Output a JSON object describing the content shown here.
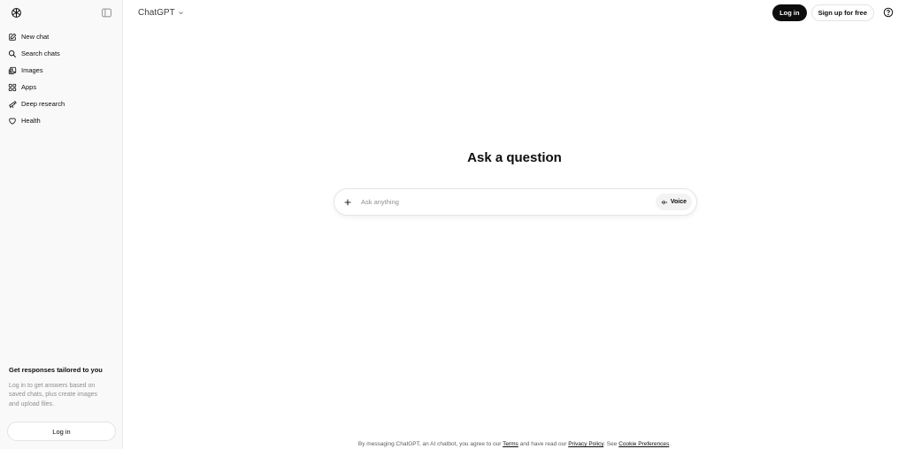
{
  "sidebar": {
    "items": [
      {
        "label": "New chat",
        "icon": "compose-icon"
      },
      {
        "label": "Search chats",
        "icon": "search-icon"
      },
      {
        "label": "Images",
        "icon": "images-icon"
      },
      {
        "label": "Apps",
        "icon": "apps-grid-icon"
      },
      {
        "label": "Deep research",
        "icon": "telescope-icon"
      },
      {
        "label": "Health",
        "icon": "heart-icon"
      }
    ],
    "promo_title": "Get responses tailored to you",
    "promo_text": "Log in to get answers based on saved chats, plus create images and upload files.",
    "login_label": "Log in"
  },
  "header": {
    "model_label": "ChatGPT",
    "login_label": "Log in",
    "signup_label": "Sign up for free"
  },
  "main": {
    "headline": "Ask a question",
    "input_placeholder": "Ask anything",
    "voice_label": "Voice"
  },
  "footer": {
    "prefix": "By messaging ChatGPT, an AI chatbot, you agree to our",
    "terms": "Terms",
    "middle": "and have read our",
    "privacy": "Privacy Policy",
    "see": ". See",
    "cookie": "Cookie Preferences",
    "end": "."
  },
  "colors": {
    "sidebar_bg": "#f9f9f9",
    "primary_button": "#0d0d0d",
    "muted_text": "#8f8f8f"
  }
}
